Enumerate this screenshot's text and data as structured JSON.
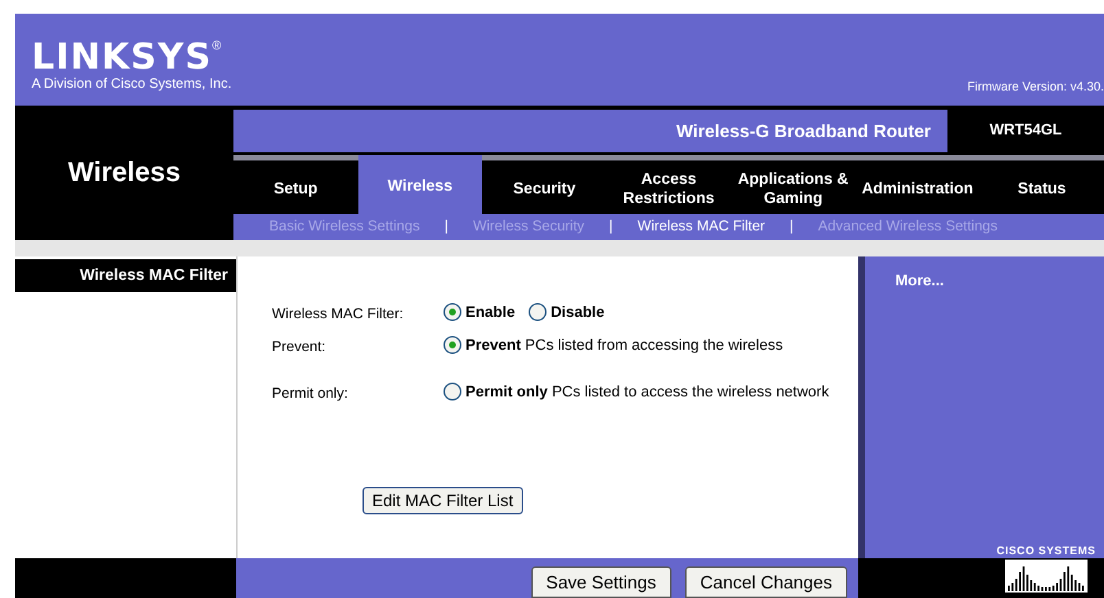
{
  "header": {
    "brand": "LINKSYS",
    "registered": "®",
    "tagline": "A Division of Cisco Systems, Inc.",
    "firmware": "Firmware Version: v4.30."
  },
  "section_title": "Wireless",
  "product": {
    "name": "Wireless-G Broadband Router",
    "model": "WRT54GL"
  },
  "tabs": [
    {
      "label": "Setup",
      "selected": false
    },
    {
      "label": "Wireless",
      "selected": true
    },
    {
      "label": "Security",
      "selected": false
    },
    {
      "label": "Access Restrictions",
      "selected": false
    },
    {
      "label": "Applications & Gaming",
      "selected": false
    },
    {
      "label": "Administration",
      "selected": false
    },
    {
      "label": "Status",
      "selected": false
    }
  ],
  "subtabs": [
    {
      "label": "Basic Wireless Settings",
      "selected": false
    },
    {
      "label": "Wireless Security",
      "selected": false
    },
    {
      "label": "Wireless MAC Filter",
      "selected": true
    },
    {
      "label": "Advanced Wireless Settings",
      "selected": false
    }
  ],
  "subtab_separators": [
    "|",
    "|",
    "|"
  ],
  "panel_title": "Wireless MAC Filter",
  "form": {
    "rows": [
      {
        "kind": "toggle",
        "label": "Wireless MAC Filter:",
        "options": [
          {
            "label": "Enable",
            "selected": true
          },
          {
            "label": "Disable",
            "selected": false
          }
        ]
      },
      {
        "kind": "choice",
        "label": "Prevent:",
        "options": [
          {
            "label": "**Prevent** PCs listed from accessing the wireless",
            "selected": true
          }
        ]
      },
      {
        "kind": "choice",
        "label": "Permit only:",
        "options": [
          {
            "label": "**Permit only** PCs listed to access the wireless network",
            "selected": false
          }
        ]
      }
    ],
    "edit_button": "Edit MAC Filter List"
  },
  "more": "More...",
  "cisco": "CISCO SYSTEMS",
  "buttons": [
    "Save Settings",
    "Cancel Changes"
  ]
}
